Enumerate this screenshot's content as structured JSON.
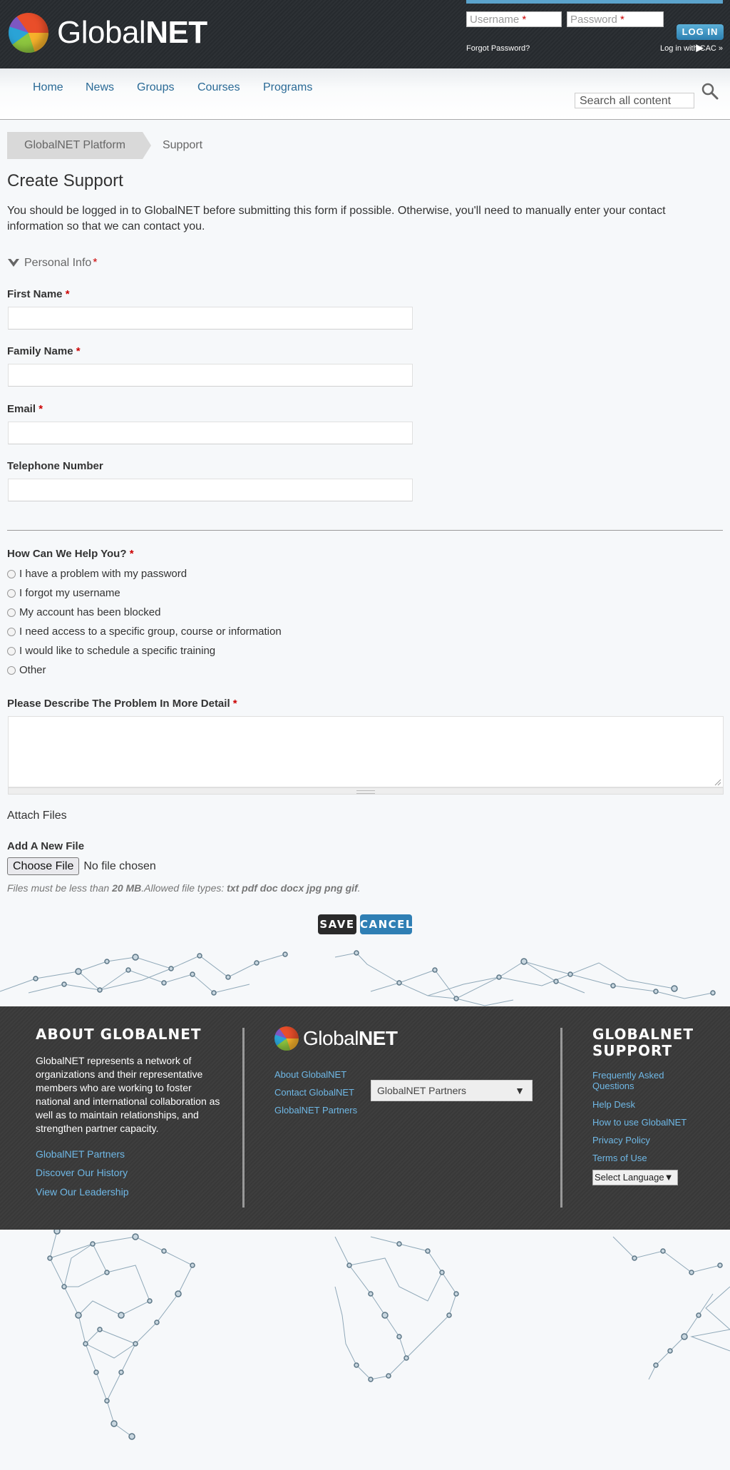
{
  "header": {
    "brand_prefix": "Global",
    "brand_suffix": "NET",
    "username_placeholder": "Username",
    "password_placeholder": "Password",
    "required_mark": "*",
    "login_label": "LOG IN ▶",
    "forgot_password": "Forgot Password?",
    "cac_login": "Log in with CAC »"
  },
  "nav": {
    "items": [
      "Home",
      "News",
      "Groups",
      "Courses",
      "Programs"
    ],
    "search_placeholder": "Search all content"
  },
  "breadcrumb": [
    "GlobalNET Platform",
    "Support"
  ],
  "page": {
    "title": "Create Support",
    "intro": "You should be logged in to GlobalNET before submitting this form if possible. Otherwise, you'll need to manually enter your contact information so that we can contact you."
  },
  "form": {
    "personal_info": "Personal Info",
    "required_mark": "*",
    "fields": {
      "first_name": "First Name",
      "family_name": "Family Name",
      "email": "Email",
      "telephone": "Telephone Number"
    },
    "help_question": "How Can We Help You?",
    "help_options": [
      "I have a problem with my password",
      "I forgot my username",
      "My account has been blocked",
      "I need access to a specific group, course or information",
      "I would like to schedule a specific training",
      "Other"
    ],
    "describe_label": "Please Describe The Problem In More Detail",
    "attach_title": "Attach Files",
    "add_file_label": "Add A New File",
    "choose_file": "Choose File",
    "no_file": "No file chosen",
    "file_help_1": "Files must be less than ",
    "file_help_size": "20 MB",
    "file_help_2": ".Allowed file types: ",
    "file_help_types": "txt pdf doc docx jpg png gif",
    "file_help_3": ".",
    "save": "SAVE",
    "cancel": "CANCEL"
  },
  "footer": {
    "about_title": "ABOUT GLOBALNET",
    "about_text": "GlobalNET represents a network of organizations and their representative members who are working to foster national and international collaboration as well as to maintain relationships, and strengthen partner capacity.",
    "about_links": [
      "GlobalNET Partners",
      "Discover Our History",
      "View Our Leadership"
    ],
    "mid_links": [
      "About GlobalNET",
      "Contact GlobalNET",
      "GlobalNET Partners"
    ],
    "partners_select": "GlobalNET Partners",
    "support_title_1": "GLOBALNET",
    "support_title_2": "SUPPORT",
    "support_links": [
      "Frequently Asked Questions",
      "Help Desk",
      "How to use GlobalNET",
      "Privacy Policy",
      "Terms of Use"
    ],
    "language_select": "Select Language",
    "dropdown_arrow": "▼"
  },
  "colors": {
    "link": "#2a6a96",
    "required": "#cc0000",
    "footer_link": "#6fb8e6",
    "cancel_button": "#2f7fb4",
    "save_button": "#2a2a2a"
  }
}
